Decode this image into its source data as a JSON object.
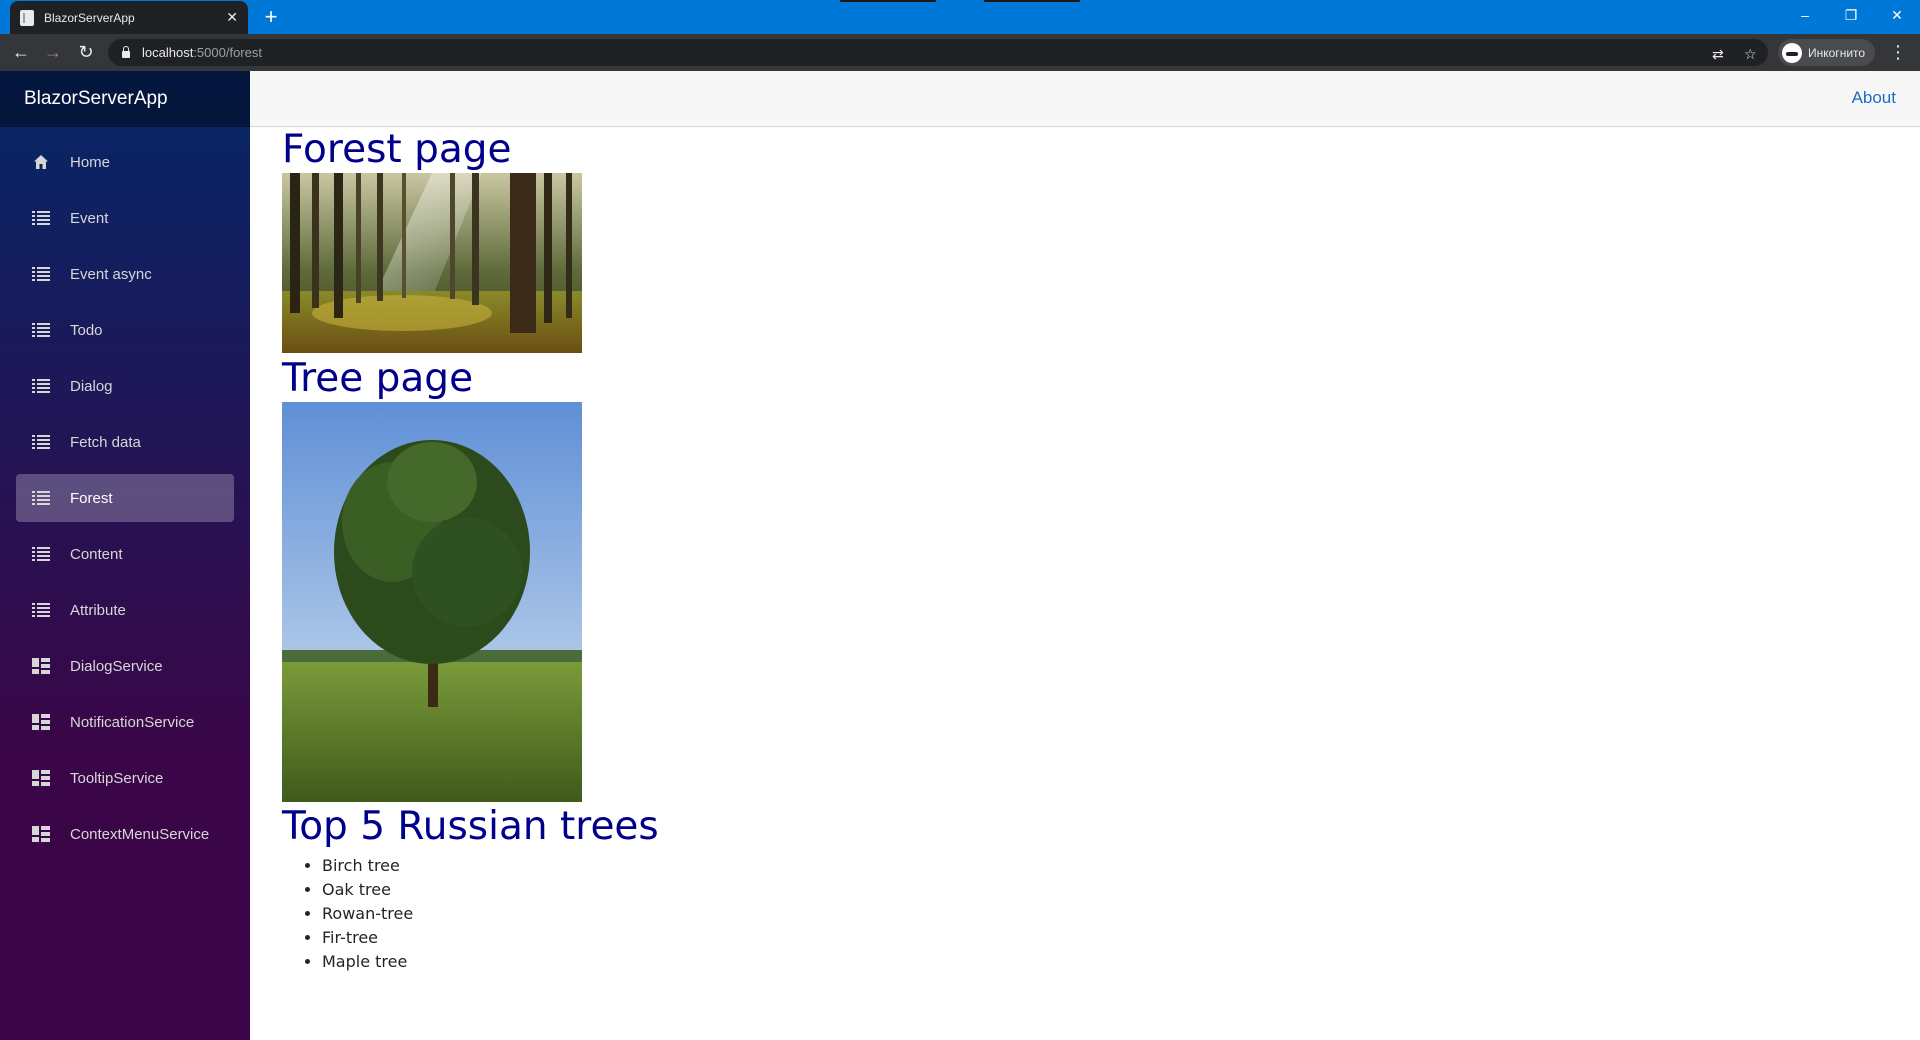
{
  "browser": {
    "tab_title": "BlazorServerApp",
    "tab_close": "✕",
    "new_tab": "+",
    "url_host": "localhost",
    "url_path": ":5000/forest",
    "incognito_label": "Инкогнито",
    "window_controls": {
      "minimize": "–",
      "restore": "❐",
      "close": "✕"
    }
  },
  "app": {
    "brand": "BlazorServerApp",
    "header_link": "About",
    "nav_items": [
      {
        "label": "Home",
        "icon": "home-icon",
        "active": false
      },
      {
        "label": "Event",
        "icon": "list-icon",
        "active": false
      },
      {
        "label": "Event async",
        "icon": "list-icon",
        "active": false
      },
      {
        "label": "Todo",
        "icon": "list-icon",
        "active": false
      },
      {
        "label": "Dialog",
        "icon": "list-icon",
        "active": false
      },
      {
        "label": "Fetch data",
        "icon": "list-icon",
        "active": false
      },
      {
        "label": "Forest",
        "icon": "list-icon",
        "active": true
      },
      {
        "label": "Content",
        "icon": "list-icon",
        "active": false
      },
      {
        "label": "Attribute",
        "icon": "list-icon",
        "active": false
      },
      {
        "label": "DialogService",
        "icon": "dashboard-icon",
        "active": false
      },
      {
        "label": "NotificationService",
        "icon": "dashboard-icon",
        "active": false
      },
      {
        "label": "TooltipService",
        "icon": "dashboard-icon",
        "active": false
      },
      {
        "label": "ContextMenuService",
        "icon": "dashboard-icon",
        "active": false
      }
    ]
  },
  "content": {
    "forest_heading": "Forest page",
    "forest_image_icon": "forest-photo",
    "tree_heading": "Tree page",
    "tree_image_icon": "tree-photo",
    "list_heading": "Top 5 Russian trees",
    "trees": [
      "Birch tree",
      "Oak tree",
      "Rowan-tree",
      "Fir-tree",
      "Maple tree"
    ]
  },
  "colors": {
    "titlebar": "#0078d7",
    "heading": "#00008b",
    "link": "#1b6ec2",
    "sidebar_top": "#052767",
    "sidebar_bottom": "#3a0647"
  }
}
